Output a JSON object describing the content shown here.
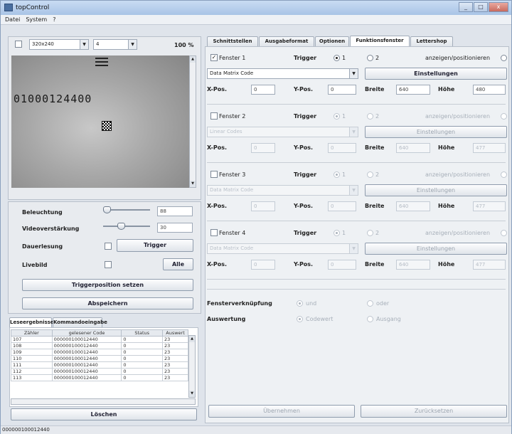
{
  "window": {
    "title": "topControl",
    "min": "_",
    "max": "□",
    "close": "x"
  },
  "menu": [
    "Datei",
    "System",
    "?"
  ],
  "toolbar": {
    "resolution": "320x240",
    "mode": "4",
    "zoom": "100 %"
  },
  "image": {
    "code_text": "01000124400"
  },
  "controls": {
    "beleuchtung_label": "Beleuchtung",
    "beleuchtung_value": "88",
    "beleuchtung_level": 0.0,
    "video_label": "Videoverstärkung",
    "video_value": "30",
    "video_level": 0.35,
    "dauerlesung_label": "Dauerlesung",
    "trigger_button": "Trigger",
    "livebild_label": "Livebild",
    "alle_button": "Alle",
    "triggerposition_button": "Triggerposition setzen",
    "abspeichern_button": "Abspeichern"
  },
  "log": {
    "tabs": [
      "Leseergebnisse",
      "Kommandoeingabe"
    ],
    "columns": [
      "Zähler",
      "gelesener Code",
      "Status",
      "Auswert"
    ],
    "rows": [
      [
        "107",
        "000000100012440",
        "0",
        "23"
      ],
      [
        "108",
        "000000100012440",
        "0",
        "23"
      ],
      [
        "109",
        "000000100012440",
        "0",
        "23"
      ],
      [
        "110",
        "000000100012440",
        "0",
        "23"
      ],
      [
        "111",
        "000000100012440",
        "0",
        "23"
      ],
      [
        "112",
        "000000100012440",
        "0",
        "23"
      ],
      [
        "113",
        "000000100012440",
        "0",
        "23"
      ]
    ],
    "clear_button": "Löschen"
  },
  "tabs": [
    "Schnittstellen",
    "Ausgabeformat",
    "Optionen",
    "Funktionsfenster",
    "Lettershop"
  ],
  "windows": [
    {
      "label": "Fenster 1",
      "enabled": true,
      "trigger_label": "Trigger",
      "opt1": "1",
      "opt2": "2",
      "show_label": "anzeigen/positionieren",
      "type": "Data Matrix Code",
      "settings": "Einstellungen",
      "xpos_label": "X-Pos.",
      "xpos": "0",
      "ypos_label": "Y-Pos.",
      "ypos": "0",
      "breite_label": "Breite",
      "breite": "640",
      "hoehe_label": "Höhe",
      "hoehe": "480"
    },
    {
      "label": "Fenster 2",
      "enabled": false,
      "trigger_label": "Trigger",
      "opt1": "1",
      "opt2": "2",
      "show_label": "anzeigen/positionieren",
      "type": "Linear Codes",
      "settings": "Einstellungen",
      "xpos_label": "X-Pos.",
      "xpos": "0",
      "ypos_label": "Y-Pos.",
      "ypos": "0",
      "breite_label": "Breite",
      "breite": "640",
      "hoehe_label": "Höhe",
      "hoehe": "477"
    },
    {
      "label": "Fenster 3",
      "enabled": false,
      "trigger_label": "Trigger",
      "opt1": "1",
      "opt2": "2",
      "show_label": "anzeigen/positionieren",
      "type": "Data Matrix Code",
      "settings": "Einstellungen",
      "xpos_label": "X-Pos.",
      "xpos": "0",
      "ypos_label": "Y-Pos.",
      "ypos": "0",
      "breite_label": "Breite",
      "breite": "640",
      "hoehe_label": "Höhe",
      "hoehe": "477"
    },
    {
      "label": "Fenster 4",
      "enabled": false,
      "trigger_label": "Trigger",
      "opt1": "1",
      "opt2": "2",
      "show_label": "anzeigen/positionieren",
      "type": "Data Matrix Code",
      "settings": "Einstellungen",
      "xpos_label": "X-Pos.",
      "xpos": "0",
      "ypos_label": "Y-Pos.",
      "ypos": "0",
      "breite_label": "Breite",
      "breite": "640",
      "hoehe_label": "Höhe",
      "hoehe": "477"
    }
  ],
  "link": {
    "label": "Fensterverknüpfung",
    "opt1": "und",
    "opt2": "oder"
  },
  "eval": {
    "label": "Auswertung",
    "opt1": "Codewert",
    "opt2": "Ausgang"
  },
  "bottom": {
    "apply": "Übernehmen",
    "reset": "Zurücksetzen"
  },
  "status": "000000100012440"
}
